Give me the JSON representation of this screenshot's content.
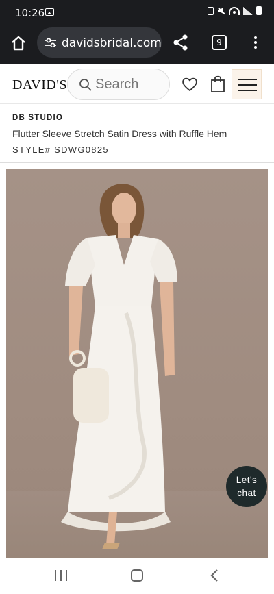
{
  "status_bar": {
    "time": "10:26",
    "icons": [
      "gallery-icon",
      "lock-icon",
      "mute-icon",
      "wifi-icon",
      "signal-icon",
      "battery-icon"
    ]
  },
  "browser": {
    "url": "davidsbridal.com",
    "tab_count": "9",
    "icons": [
      "home-icon",
      "tune-icon",
      "share-icon",
      "more-vert-icon"
    ]
  },
  "site_header": {
    "logo": "DAVID'S",
    "search_placeholder": "Search",
    "icons": [
      "search-icon",
      "heart-icon",
      "bag-icon",
      "hamburger-menu-icon"
    ]
  },
  "product": {
    "brand": "DB STUDIO",
    "title": "Flutter Sleeve Stretch Satin Dress with Ruffle Hem",
    "style_number": "STYLE# SDWG0825"
  },
  "chat": {
    "label_line1": "Let's",
    "label_line2": "chat"
  },
  "colors": {
    "chrome_bg": "#1b1c1f",
    "url_pill": "#34363b",
    "image_bg": "#a59287",
    "chat_bg": "#1f2a2b",
    "hamburger_bg": "#fbf3ea"
  }
}
